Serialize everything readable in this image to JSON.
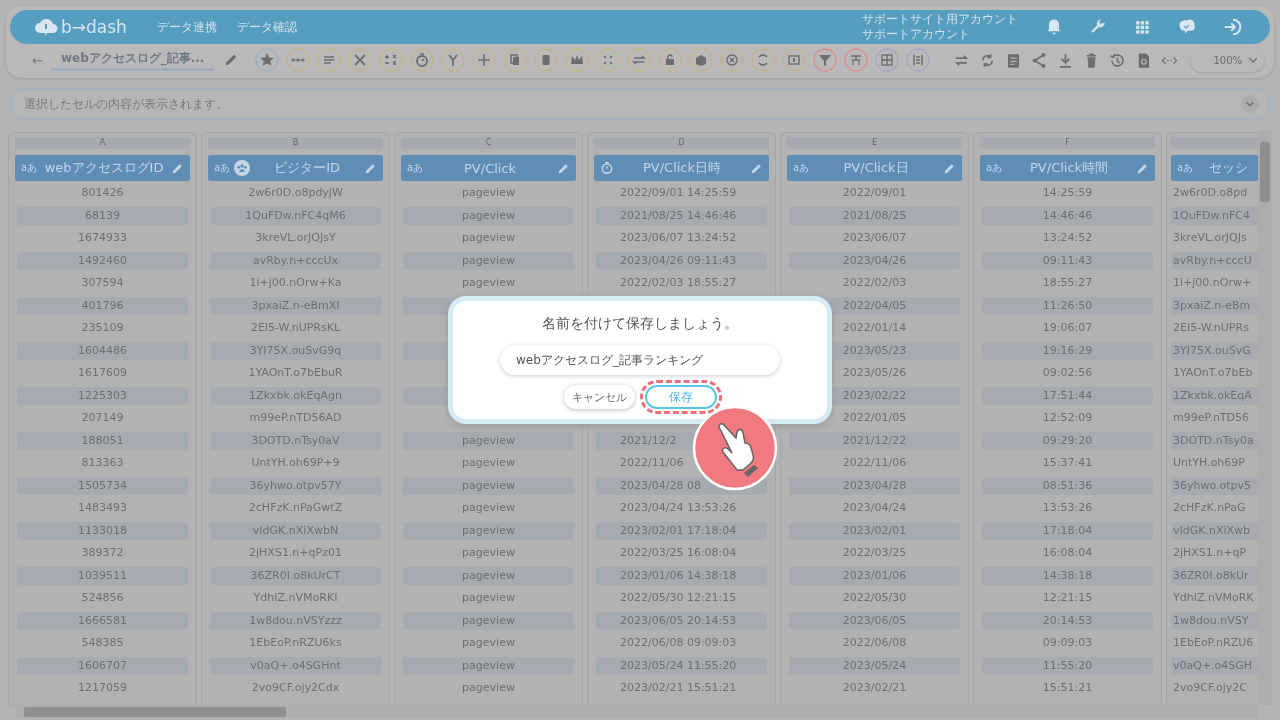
{
  "header": {
    "logo": "b→dash",
    "nav": [
      {
        "label": "データ連携"
      },
      {
        "label": "データ確認"
      }
    ],
    "account": {
      "line_1": "サポートサイト用アカウント",
      "line_2": "サポートアカウント"
    }
  },
  "toolbar": {
    "back": "←",
    "title": "webアクセスログ_記事...",
    "zoom": "100%"
  },
  "cell_viewer": {
    "placeholder": "選択したセルの内容が表示されます。"
  },
  "table": {
    "columns": [
      {
        "letter": "A",
        "name": "webアクセスログID",
        "kind": "text",
        "badge": "aあ",
        "linked": false,
        "clipped": false
      },
      {
        "letter": "B",
        "name": "ビジターID",
        "kind": "text",
        "badge": "aあ",
        "linked": true,
        "clipped": false
      },
      {
        "letter": "C",
        "name": "PV/Click",
        "kind": "text",
        "badge": "aあ",
        "linked": false,
        "clipped": false
      },
      {
        "letter": "D",
        "name": "PV/Click日時",
        "kind": "datetime",
        "linked": false,
        "clipped": false
      },
      {
        "letter": "E",
        "name": "PV/Click日",
        "kind": "text",
        "badge": "aあ",
        "linked": false,
        "clipped": false
      },
      {
        "letter": "F",
        "name": "PV/Click時間",
        "kind": "text",
        "badge": "aあ",
        "linked": false,
        "clipped": false
      },
      {
        "name": "セッシ",
        "kind": "text",
        "badge": "aあ",
        "linked": false,
        "clipped": true
      }
    ],
    "rows": [
      [
        "801426",
        "2w6r0D.o8pdyjW",
        "pageview",
        "2022/09/01 14:25:59",
        "2022/09/01",
        "14:25:59",
        "2w6r0D.o8pd"
      ],
      [
        "68139",
        "1QuFDw.nFC4qM6",
        "pageview",
        "2021/08/25 14:46:46",
        "2021/08/25",
        "14:46:46",
        "1QuFDw.nFC4"
      ],
      [
        "1674933",
        "3kreVL.orJQJsY",
        "pageview",
        "2023/06/07 13:24:52",
        "2023/06/07",
        "13:24:52",
        "3kreVL.orJQJs"
      ],
      [
        "1492460",
        "avRby.n+cccUx",
        "pageview",
        "2023/04/26 09:11:43",
        "2023/04/26",
        "09:11:43",
        "avRby.n+cccU"
      ],
      [
        "307594",
        "1i+j00.nOrw+Ka",
        "pageview",
        "2022/02/03 18:55:27",
        "2022/02/03",
        "18:55:27",
        "1i+j00.nOrw+"
      ],
      [
        "401796",
        "3pxaiZ.n-eBmXI",
        null,
        null,
        "2022/04/05",
        "11:26:50",
        "3pxaiZ.n-eBm"
      ],
      [
        "235109",
        "2EI5-W.nUPRsKL",
        null,
        null,
        "2022/01/14",
        "19:06:07",
        "2EI5-W.nUPRs"
      ],
      [
        "1604486",
        "3YI75X.ouSvG9q",
        null,
        null,
        "2023/05/23",
        "19:16:29",
        "3YI75X.ouSvG"
      ],
      [
        "1617609",
        "1YAOnT.o7bEbuR",
        null,
        null,
        "2023/05/26",
        "09:02:56",
        "1YAOnT.o7bEb"
      ],
      [
        "1225303",
        "1Zkxbk.okEqAgn",
        null,
        null,
        "2023/02/22",
        "17:51:44",
        "1Zkxbk.okEqA"
      ],
      [
        "207149",
        "m99eP.nTD56AD",
        null,
        null,
        "2022/01/05",
        "12:52:09",
        "m99eP.nTD56"
      ],
      [
        "188051",
        "3DOTD.nTsy0aV",
        "pageview",
        "2021/12/2",
        "2021/12/22",
        "09:29:20",
        "3DOTD.nTsy0a"
      ],
      [
        "813363",
        "UntYH.oh69P+9",
        "pageview",
        "2022/11/06",
        "2022/11/06",
        "15:37:41",
        "UntYH.oh69P"
      ],
      [
        "1505734",
        "36yhwo.otpv57Y",
        "pageview",
        "2023/04/28 08",
        "2023/04/28",
        "08:51:36",
        "36yhwo.otpv5"
      ],
      [
        "1483493",
        "2cHFzK.nPaGwtZ",
        "pageview",
        "2023/04/24 13:53:26",
        "2023/04/24",
        "13:53:26",
        "2cHFzK.nPaG"
      ],
      [
        "1133018",
        "vIdGK.nXiXwbN",
        "pageview",
        "2023/02/01 17:18:04",
        "2023/02/01",
        "17:18:04",
        "vIdGK.nXiXwb"
      ],
      [
        "389372",
        "2jHXS1.n+qPz01",
        "pageview",
        "2022/03/25 16:08:04",
        "2022/03/25",
        "16:08:04",
        "2jHXS1.n+qP"
      ],
      [
        "1039511",
        "36ZR0I.o8kUrCT",
        "pageview",
        "2023/01/06 14:38:18",
        "2023/01/06",
        "14:38:18",
        "36ZR0I.o8kUr"
      ],
      [
        "524856",
        "YdhIZ.nVMoRKI",
        "pageview",
        "2022/05/30 12:21:15",
        "2022/05/30",
        "12:21:15",
        "YdhIZ.nVMoRK"
      ],
      [
        "1666581",
        "1w8dou.nVSYzzz",
        "pageview",
        "2023/06/05 20:14:53",
        "2023/06/05",
        "20:14:53",
        "1w8dou.nVSY"
      ],
      [
        "548385",
        "1EbEoP.nRZU6ks",
        "pageview",
        "2022/06/08 09:09:03",
        "2022/06/08",
        "09:09:03",
        "1EbEoP.nRZU6"
      ],
      [
        "1606707",
        "v0aQ+.o4SGHnt",
        "pageview",
        "2023/05/24 11:55:20",
        "2023/05/24",
        "11:55:20",
        "v0aQ+.o4SGH"
      ],
      [
        "1217059",
        "2vo9CF.ojy2Cdx",
        "pageview",
        "2023/02/21 15:51:21",
        "2023/02/21",
        "15:51:21",
        "2vo9CF.ojy2C"
      ]
    ]
  },
  "dialog": {
    "title": "名前を付けて保存しましょう。",
    "value": "webアクセスログ_記事ランキング",
    "cancel": "キャンセル",
    "save": "保存",
    "save_highlighted": true,
    "tap_hint": true
  }
}
